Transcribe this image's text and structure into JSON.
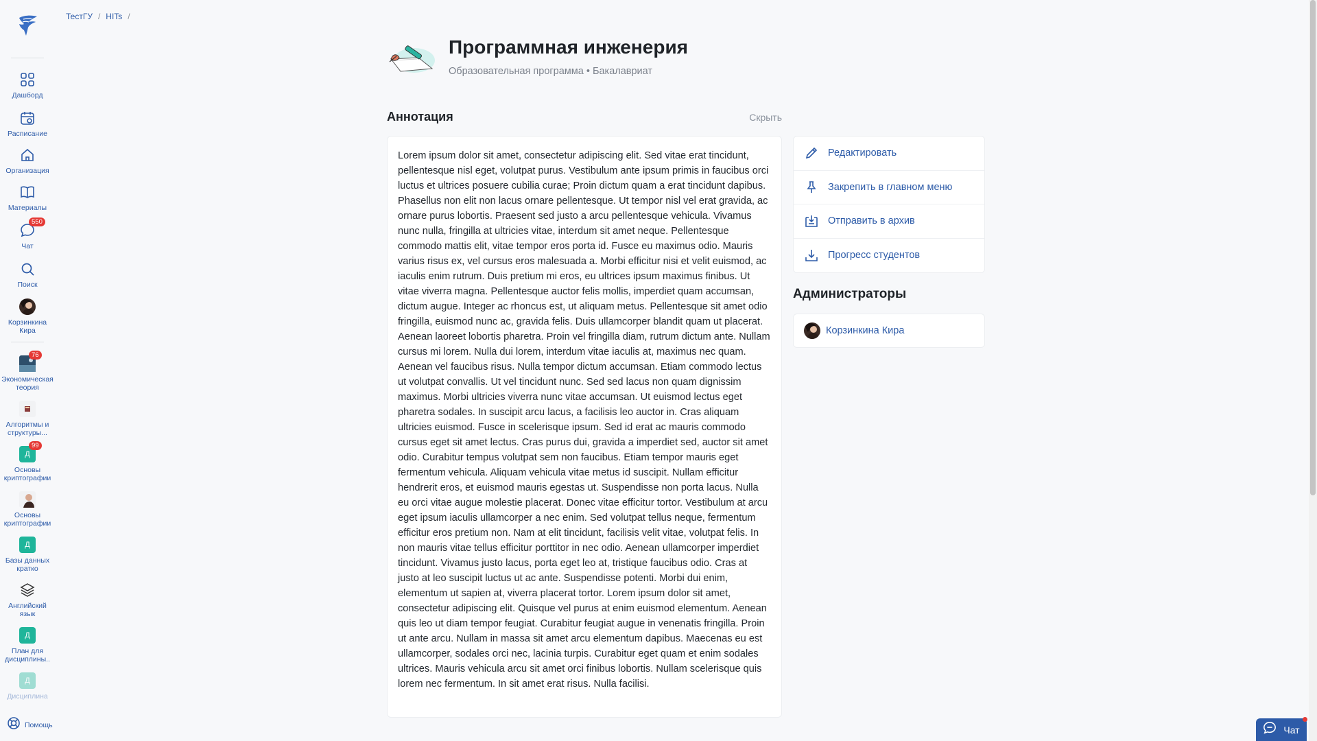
{
  "breadcrumb": {
    "items": [
      "ТестГУ",
      "HITs"
    ],
    "separator": "/"
  },
  "sidebar": {
    "nav": [
      {
        "label": "Дашборд",
        "icon": "grid-icon"
      },
      {
        "label": "Расписание",
        "icon": "calendar-icon"
      },
      {
        "label": "Организация",
        "icon": "home-icon"
      },
      {
        "label": "Материалы",
        "icon": "book-icon"
      },
      {
        "label": "Чат",
        "icon": "chat-icon",
        "badge": "550"
      },
      {
        "label": "Поиск",
        "icon": "search-icon"
      },
      {
        "label": "Корзинкина Кира",
        "icon": "user-avatar"
      }
    ],
    "courses": [
      {
        "label": "Экономическая теория",
        "badge": "76"
      },
      {
        "label": "Алгоритмы и структуры..."
      },
      {
        "label": "Основы криптографии",
        "initial": "Д",
        "badge": "99"
      },
      {
        "label": "Основы криптографии"
      },
      {
        "label": "Базы данных кратко",
        "initial": "Д"
      },
      {
        "label": "Английский язык"
      },
      {
        "label": "План для дисциплины..",
        "initial": "Д"
      },
      {
        "label": "Дисциплина",
        "initial": "Д"
      }
    ],
    "help_label": "Помощь"
  },
  "header": {
    "title": "Программная инженерия",
    "subtitle": "Образовательная программа • Бакалавриат"
  },
  "annotation": {
    "title": "Аннотация",
    "hide_label": "Скрыть",
    "text": "Lorem ipsum dolor sit amet, consectetur adipiscing elit. Sed vitae erat tincidunt, pellentesque nisl eget, volutpat purus. Vestibulum ante ipsum primis in faucibus orci luctus et ultrices posuere cubilia curae; Proin dictum quam a erat tincidunt dapibus. Phasellus non elit non lacus ornare pellentesque. Ut tempor nisl vel erat gravida, ac ornare purus lobortis. Praesent sed justo a arcu pellentesque vehicula. Vivamus nunc nulla, fringilla at ultricies vitae, interdum sit amet neque. Pellentesque commodo mattis elit, vitae tempor eros porta id. Fusce eu maximus odio. Mauris varius risus ex, vel cursus eros malesuada a. Morbi efficitur nisi et velit euismod, ac iaculis enim rutrum. Duis pretium mi eros, eu ultrices ipsum maximus finibus. Ut vitae viverra magna. Pellentesque auctor felis mollis, imperdiet quam accumsan, dictum augue. Integer ac rhoncus est, ut aliquam metus. Pellentesque sit amet odio fringilla, euismod nunc ac, gravida felis. Duis ullamcorper blandit quam ut placerat. Aenean laoreet lobortis pharetra. Proin vel fringilla diam, rutrum dictum ante. Nullam cursus mi lorem. Nulla dui lorem, interdum vitae iaculis at, maximus nec quam. Aenean vel faucibus risus. Nulla tempor dictum accumsan. Etiam commodo lectus ut volutpat convallis. Ut vel tincidunt nunc. Sed sed lacus non quam dignissim maximus. Morbi ultricies viverra nunc vitae accumsan. Ut euismod lectus eget pharetra sodales. In suscipit arcu lacus, a facilisis leo auctor in. Cras aliquam ultricies euismod. Fusce in scelerisque ipsum. Sed id erat ac mauris commodo cursus eget sit amet lectus. Cras purus dui, gravida a imperdiet sed, auctor sit amet odio. Curabitur tempus volutpat sem non faucibus. Etiam tempor mauris eget fermentum vehicula. Aliquam vehicula vitae metus id suscipit. Nullam efficitur hendrerit eros, et euismod mauris egestas ut. Suspendisse non porta lacus. Nulla eu orci vitae augue molestie placerat. Donec vitae efficitur tortor. Vestibulum at arcu eget ipsum iaculis ullamcorper a nec enim. Sed volutpat tellus neque, fermentum efficitur eros pretium non. Nam at elit tincidunt, facilisis velit vitae, volutpat felis. In non mauris vitae tellus efficitur porttitor in nec odio. Aenean ullamcorper imperdiet tincidunt. Vivamus justo lacus, porta eget leo at, tristique faucibus odio. Cras at justo at leo suscipit luctus ut ac ante. Suspendisse potenti. Morbi dui enim, elementum ut sapien at, viverra placerat tortor. Lorem ipsum dolor sit amet, consectetur adipiscing elit. Quisque vel purus at enim euismod elementum. Aenean quis leo ut diam tempor feugiat. Curabitur feugiat augue in venenatis fringilla. Proin ut ante arcu. Nullam in massa sit amet arcu elementum dapibus. Maecenas eu est ullamcorper, sodales orci nec, lacinia turpis. Curabitur eget quam et enim sodales ultrices. Mauris vehicula arcu sit amet orci finibus lobortis. Nullam scelerisque quis lorem nec fermentum. In sit amet erat risus. Nulla facilisi."
  },
  "actions": [
    {
      "label": "Редактировать",
      "icon": "pencil-icon"
    },
    {
      "label": "Закрепить в главном меню",
      "icon": "pin-icon"
    },
    {
      "label": "Отправить в архив",
      "icon": "archive-icon"
    },
    {
      "label": "Прогресс студентов",
      "icon": "download-icon"
    }
  ],
  "admins": {
    "title": "Администраторы",
    "items": [
      {
        "name": "Корзинкина Кира"
      }
    ]
  },
  "chat_button": {
    "label": "Чат"
  },
  "colors": {
    "accent": "#2d5ba8",
    "badge": "#e53935",
    "teal": "#1fb59a"
  }
}
